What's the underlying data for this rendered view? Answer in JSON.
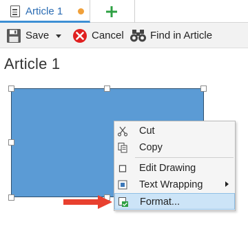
{
  "tab": {
    "title": "Article 1",
    "unsaved_indicator_color": "#f0a03a",
    "add_tab_icon": "plus-icon"
  },
  "toolbar": {
    "save_label": "Save",
    "cancel_label": "Cancel",
    "find_label": "Find in Article"
  },
  "article": {
    "title": "Article 1"
  },
  "context_menu": {
    "cut": "Cut",
    "copy": "Copy",
    "edit_drawing": "Edit Drawing",
    "text_wrapping": "Text Wrapping",
    "format": "Format..."
  },
  "colors": {
    "accent": "#3d8fd4",
    "drawing_fill": "#5b9bd5",
    "cancel_red": "#e02020",
    "add_green": "#2ea043",
    "highlight": "#cce4f7",
    "annotation_arrow": "#e8402f"
  }
}
